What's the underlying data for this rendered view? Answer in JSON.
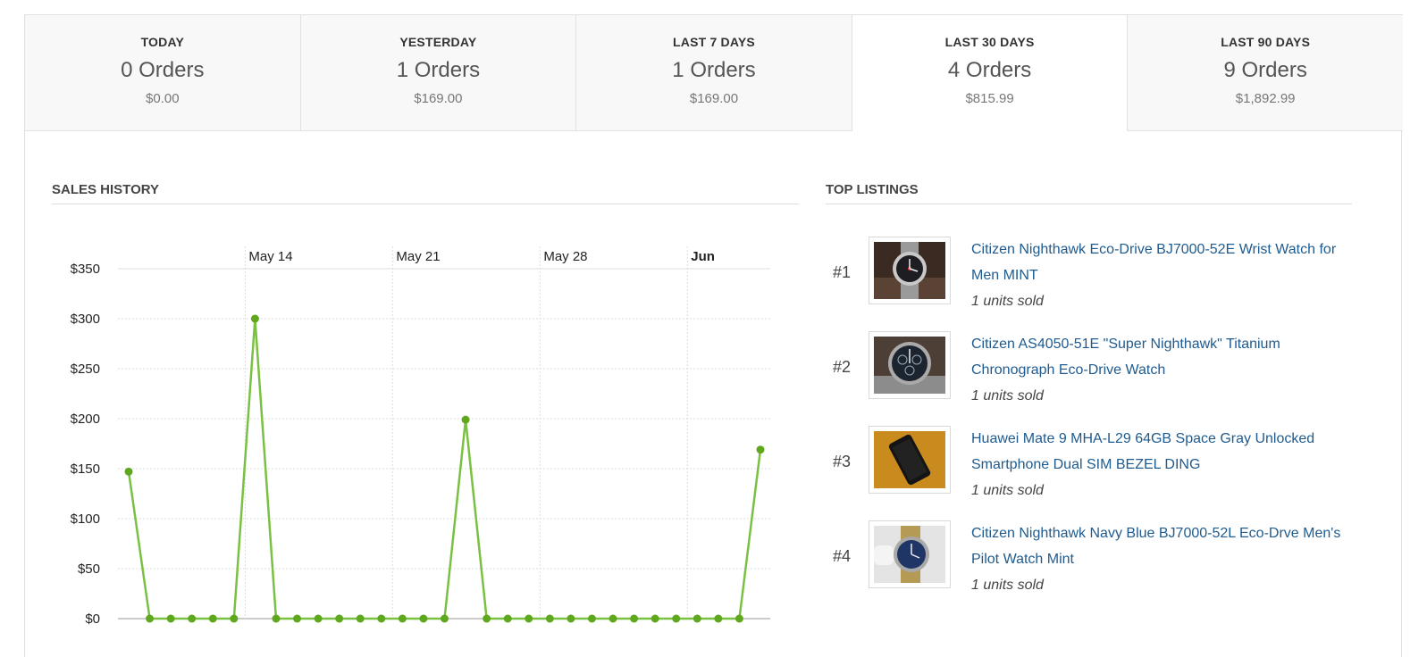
{
  "tabs": [
    {
      "label": "TODAY",
      "orders": "0 Orders",
      "amount": "$0.00",
      "active": false
    },
    {
      "label": "YESTERDAY",
      "orders": "1 Orders",
      "amount": "$169.00",
      "active": false
    },
    {
      "label": "LAST 7 DAYS",
      "orders": "1 Orders",
      "amount": "$169.00",
      "active": false
    },
    {
      "label": "LAST 30 DAYS",
      "orders": "4 Orders",
      "amount": "$815.99",
      "active": true
    },
    {
      "label": "LAST 90 DAYS",
      "orders": "9 Orders",
      "amount": "$1,892.99",
      "active": false
    }
  ],
  "sales_history": {
    "title": "SALES HISTORY"
  },
  "chart_data": {
    "type": "line",
    "title": "",
    "xlabel": "",
    "ylabel": "",
    "x": [
      "2017-05-08",
      "2017-05-09",
      "2017-05-10",
      "2017-05-11",
      "2017-05-12",
      "2017-05-13",
      "2017-05-14",
      "2017-05-15",
      "2017-05-16",
      "2017-05-17",
      "2017-05-18",
      "2017-05-19",
      "2017-05-20",
      "2017-05-21",
      "2017-05-22",
      "2017-05-23",
      "2017-05-24",
      "2017-05-25",
      "2017-05-26",
      "2017-05-27",
      "2017-05-28",
      "2017-05-29",
      "2017-05-30",
      "2017-05-31",
      "2017-06-01",
      "2017-06-02",
      "2017-06-03",
      "2017-06-04",
      "2017-06-05",
      "2017-06-06",
      "2017-06-07"
    ],
    "series": [
      {
        "values": [
          147,
          0,
          0,
          0,
          0,
          0,
          300,
          0,
          0,
          0,
          0,
          0,
          0,
          0,
          0,
          0,
          199,
          0,
          0,
          0,
          0,
          0,
          0,
          0,
          0,
          0,
          0,
          0,
          0,
          0,
          169
        ]
      }
    ],
    "x_ticks": [
      "May 14",
      "May 21",
      "May 28",
      "Jun"
    ],
    "y_ticks": [
      "$0",
      "$50",
      "$100",
      "$150",
      "$200",
      "$250",
      "$300",
      "$350"
    ],
    "ylim": [
      0,
      350
    ],
    "grid": true,
    "color": "#7ac143"
  },
  "top_listings": {
    "title": "TOP LISTINGS",
    "items": [
      {
        "rank": "#1",
        "title": "Citizen Nighthawk Eco-Drive BJ7000-52E Wrist Watch for Men MINT",
        "sold": "1 units sold",
        "thumb": "watch-black-dial"
      },
      {
        "rank": "#2",
        "title": "Citizen AS4050-51E \"Super Nighthawk\" Titanium Chronograph Eco-Drive Watch",
        "sold": "1 units sold",
        "thumb": "watch-chronograph"
      },
      {
        "rank": "#3",
        "title": "Huawei Mate 9 MHA-L29 64GB Space Gray Unlocked Smartphone Dual SIM BEZEL DING",
        "sold": "1 units sold",
        "thumb": "smartphone"
      },
      {
        "rank": "#4",
        "title": "Citizen Nighthawk Navy Blue BJ7000-52L Eco-Drve Men's Pilot Watch Mint",
        "sold": "1 units sold",
        "thumb": "watch-blue-dial"
      }
    ]
  }
}
